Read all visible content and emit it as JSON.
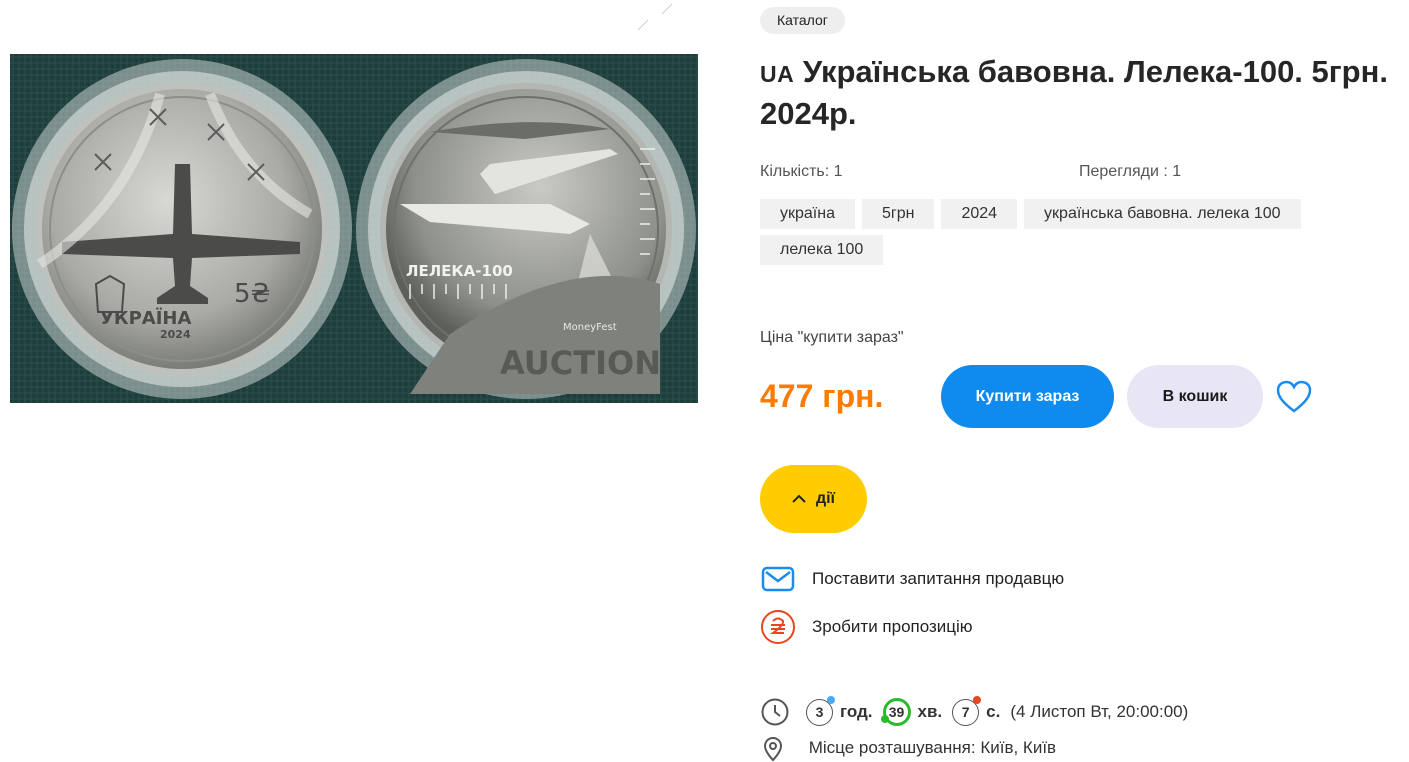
{
  "breadcrumb": {
    "catalog_label": "Каталог"
  },
  "product": {
    "flag_code": "UA",
    "title": "Українська бавовна. Лелека-100. 5грн. 2024р.",
    "quantity": "Кількість: 1",
    "views": "Перегляди : 1",
    "tags": [
      "україна",
      "5грн",
      "2024",
      "українська бавовна. лелека 100",
      "лелека 100"
    ]
  },
  "image": {
    "coin_left_country": "УКРАЇНА",
    "coin_left_year": "2024",
    "coin_left_value": "5₴",
    "coin_right_name": "ЛЕЛЕКА-100",
    "watermark_small": "MoneyFest",
    "watermark_big": "AUCTION"
  },
  "pricing": {
    "label": "Ціна \"купити зараз\"",
    "price": "477 грн.",
    "buy_now_label": "Купити зараз",
    "cart_label": "В кошик"
  },
  "actions": {
    "toggle_label": "дії",
    "ask_seller_label": "Поставити запитання продавцю",
    "make_offer_label": "Зробити пропозицію"
  },
  "timer": {
    "hours": "3",
    "hours_unit": "год.",
    "minutes": "39",
    "minutes_unit": "хв.",
    "seconds": "7",
    "seconds_unit": "с.",
    "end_text": "(4 Листоп Вт, 20:00:00)"
  },
  "location": {
    "text": "Місце розташування: Київ, Київ"
  },
  "colors": {
    "accent_blue": "#0f8bf0",
    "price_orange": "#ff7a00",
    "actions_yellow": "#ffcc00",
    "offer_red": "#e8461e"
  },
  "icons": [
    "expand-icon",
    "heart-icon",
    "chevron-up-icon",
    "mail-icon",
    "hryvnia-icon",
    "clock-icon",
    "location-pin-icon"
  ]
}
